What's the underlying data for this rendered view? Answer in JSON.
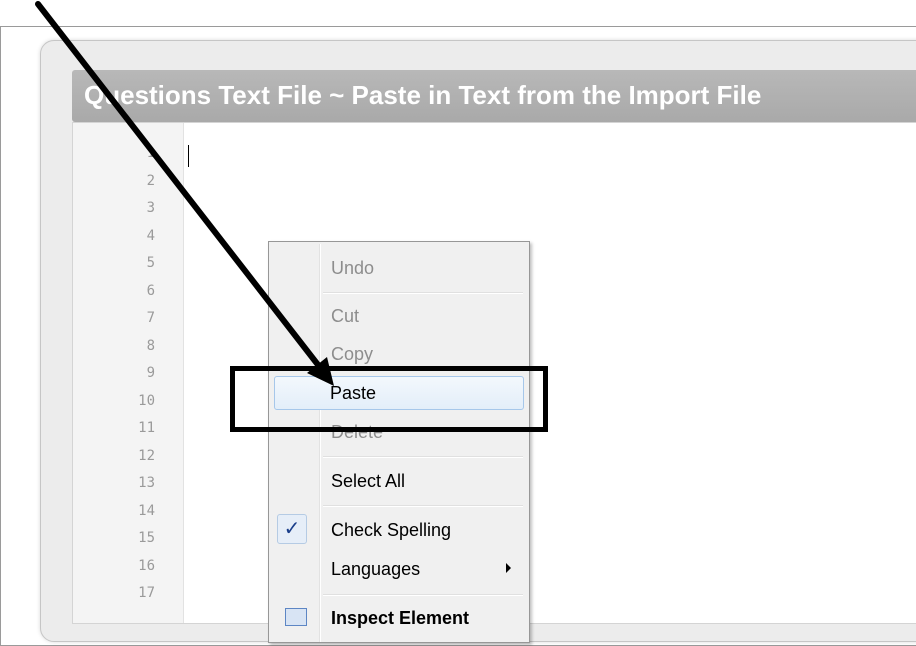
{
  "title": "Questions Text File ~ Paste in Text from the Import File",
  "line_numbers": [
    "1",
    "2",
    "3",
    "4",
    "5",
    "6",
    "7",
    "8",
    "9",
    "10",
    "11",
    "12",
    "13",
    "14",
    "15",
    "16",
    "17"
  ],
  "context_menu": {
    "undo": "Undo",
    "cut": "Cut",
    "copy": "Copy",
    "paste": "Paste",
    "delete": "Delete",
    "select_all": "Select All",
    "check_spelling": "Check Spelling",
    "check_mark": "✓",
    "languages": "Languages",
    "inspect_element": "Inspect Element"
  },
  "annotation": {
    "arrow_color": "#000000",
    "highlight_target": "Paste"
  }
}
